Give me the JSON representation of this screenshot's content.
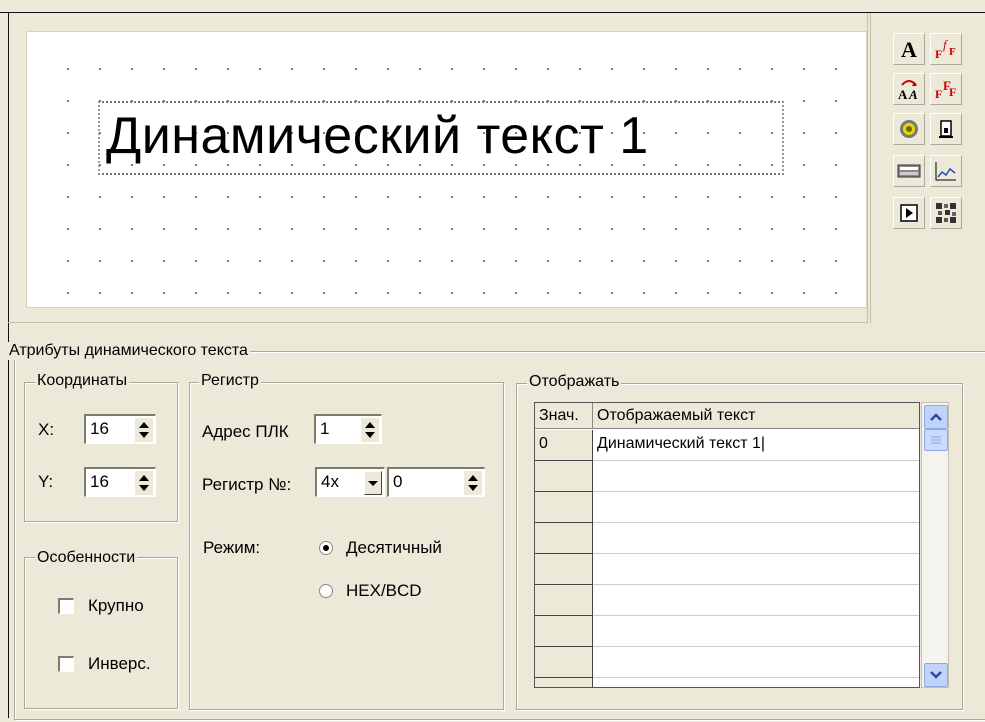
{
  "preview": {
    "dynamic_text": "Динамический текст 1"
  },
  "toolbar": {
    "icons": [
      "text-A-icon",
      "font-style-icon",
      "text-rotate-icon",
      "font-replace-icon",
      "lamp-icon",
      "door-icon",
      "keypad-icon",
      "trend-chart-icon",
      "play-icon",
      "barcode-icon"
    ]
  },
  "attributes": {
    "group_title": "Атрибуты динамического текста",
    "coords": {
      "title": "Координаты",
      "x_label": "X:",
      "x_value": "16",
      "y_label": "Y:",
      "y_value": "16"
    },
    "features": {
      "title": "Особенности",
      "large_label": "Крупно",
      "invert_label": "Инверс."
    },
    "register": {
      "title": "Регистр",
      "plc_label": "Адрес ПЛК",
      "plc_value": "1",
      "reg_label": "Регистр №:",
      "reg_type": "4x",
      "reg_value": "0",
      "mode_label": "Режим:",
      "mode_decimal": "Десятичный",
      "mode_hex": "HEX/BCD"
    },
    "display": {
      "title": "Отображать",
      "col_value": "Знач.",
      "col_text": "Отображаемый текст",
      "rows": [
        {
          "key": "0",
          "text": "Динамический текст 1"
        },
        {
          "key": "",
          "text": ""
        },
        {
          "key": "",
          "text": ""
        },
        {
          "key": "",
          "text": ""
        },
        {
          "key": "",
          "text": ""
        },
        {
          "key": "",
          "text": ""
        },
        {
          "key": "",
          "text": ""
        },
        {
          "key": "",
          "text": ""
        },
        {
          "key": "",
          "text": ""
        }
      ]
    }
  }
}
